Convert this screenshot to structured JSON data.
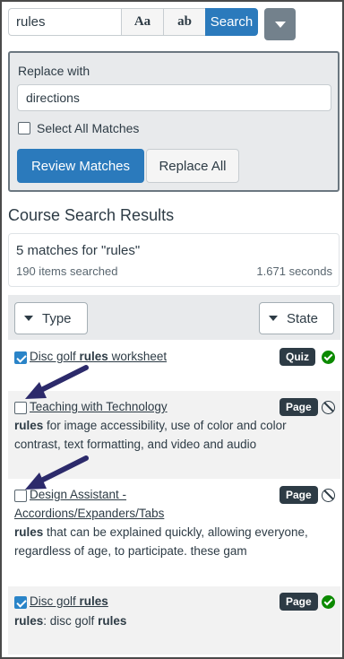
{
  "search": {
    "value": "rules",
    "match_case_label": "Aa",
    "whole_word_label": "ab",
    "search_label": "Search"
  },
  "replace": {
    "label": "Replace with",
    "value": "directions",
    "select_all_label": "Select All Matches",
    "select_all_checked": false,
    "review_label": "Review Matches",
    "replace_all_label": "Replace All"
  },
  "results_heading": "Course Search Results",
  "summary": {
    "count": "5 matches for \"rules\"",
    "items": "190 items searched",
    "time": "1.671 seconds"
  },
  "filters": {
    "type_label": "Type",
    "state_label": "State"
  },
  "results": [
    {
      "checked": true,
      "title_pre": "Disc golf ",
      "title_bold": "rules",
      "title_post": " worksheet",
      "title_line2": "",
      "badge": "Quiz",
      "state": "published",
      "desc_bold": "",
      "desc": ""
    },
    {
      "checked": false,
      "title_pre": "Teaching with Technology",
      "title_bold": "",
      "title_post": "",
      "title_line2": "",
      "badge": "Page",
      "state": "unpublished",
      "desc_bold": "rules",
      "desc": " for image accessibility, use of color and color contrast, text formatting, and video and audio"
    },
    {
      "checked": false,
      "title_pre": "Design Assistant -",
      "title_bold": "",
      "title_post": "",
      "title_line2": "Accordions/Expanders/Tabs",
      "badge": "Page",
      "state": "unpublished",
      "desc_bold": "rules",
      "desc": " that can be explained quickly, allowing everyone, regardless of age, to participate. these gam"
    },
    {
      "checked": true,
      "title_pre": "Disc golf ",
      "title_bold": "rules",
      "title_post": "",
      "title_line2": "",
      "badge": "Page",
      "state": "published",
      "desc_bold": "rules",
      "desc": ": disc golf ",
      "desc_bold2": "rules"
    }
  ],
  "colors": {
    "primary": "#2b7abc",
    "text": "#2d3b45",
    "published": "#0b8a00",
    "arrow": "#2c2a6b"
  }
}
